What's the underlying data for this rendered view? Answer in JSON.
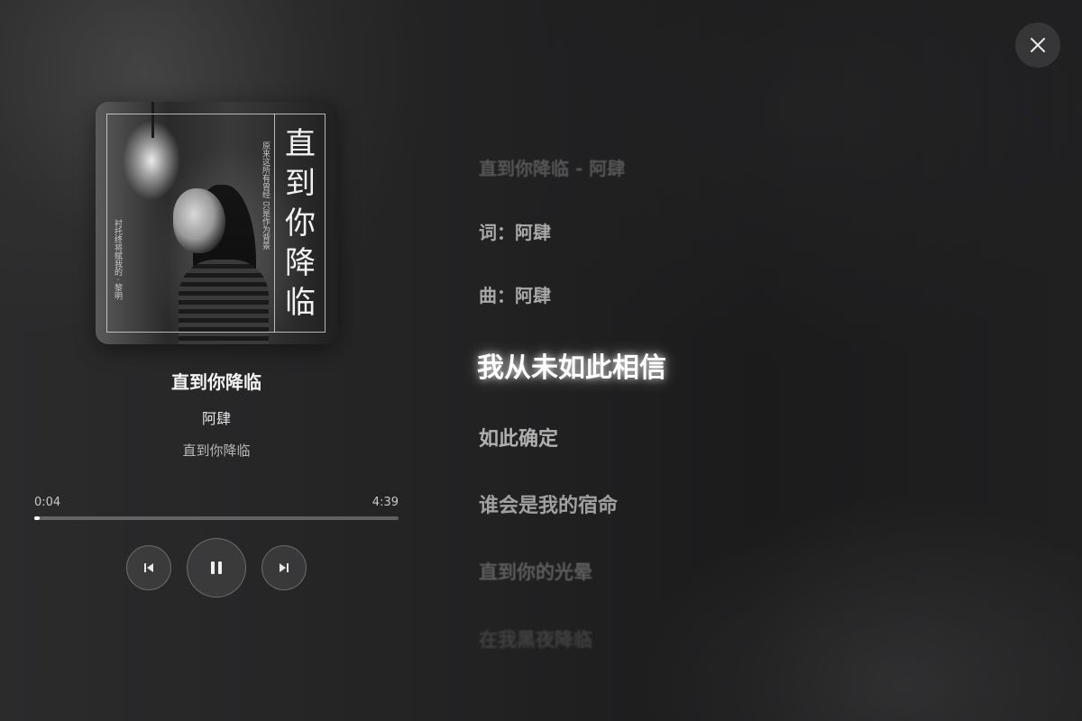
{
  "window": {
    "close_icon": "close-icon"
  },
  "song": {
    "title": "直到你降临",
    "artist": "阿肆",
    "album": "直到你降临"
  },
  "cover": {
    "title_chars": [
      "直",
      "到",
      "你",
      "降",
      "临"
    ],
    "text_right": "原来这所有曾经 只是作为背景",
    "text_left": "衬托终将赋我的 · 黎明"
  },
  "player": {
    "current_time": "0:04",
    "total_time": "4:39",
    "progress": 0.014,
    "prev_icon": "skip-previous-icon",
    "pause_icon": "pause-icon",
    "next_icon": "skip-next-icon"
  },
  "lyrics": {
    "active_index": 3,
    "lines": [
      "直到你降临 - 阿肆",
      "词：阿肆",
      "曲：阿肆",
      "我从未如此相信",
      "如此确定",
      "谁会是我的宿命",
      "直到你的光晕",
      "在我黑夜降临"
    ]
  }
}
